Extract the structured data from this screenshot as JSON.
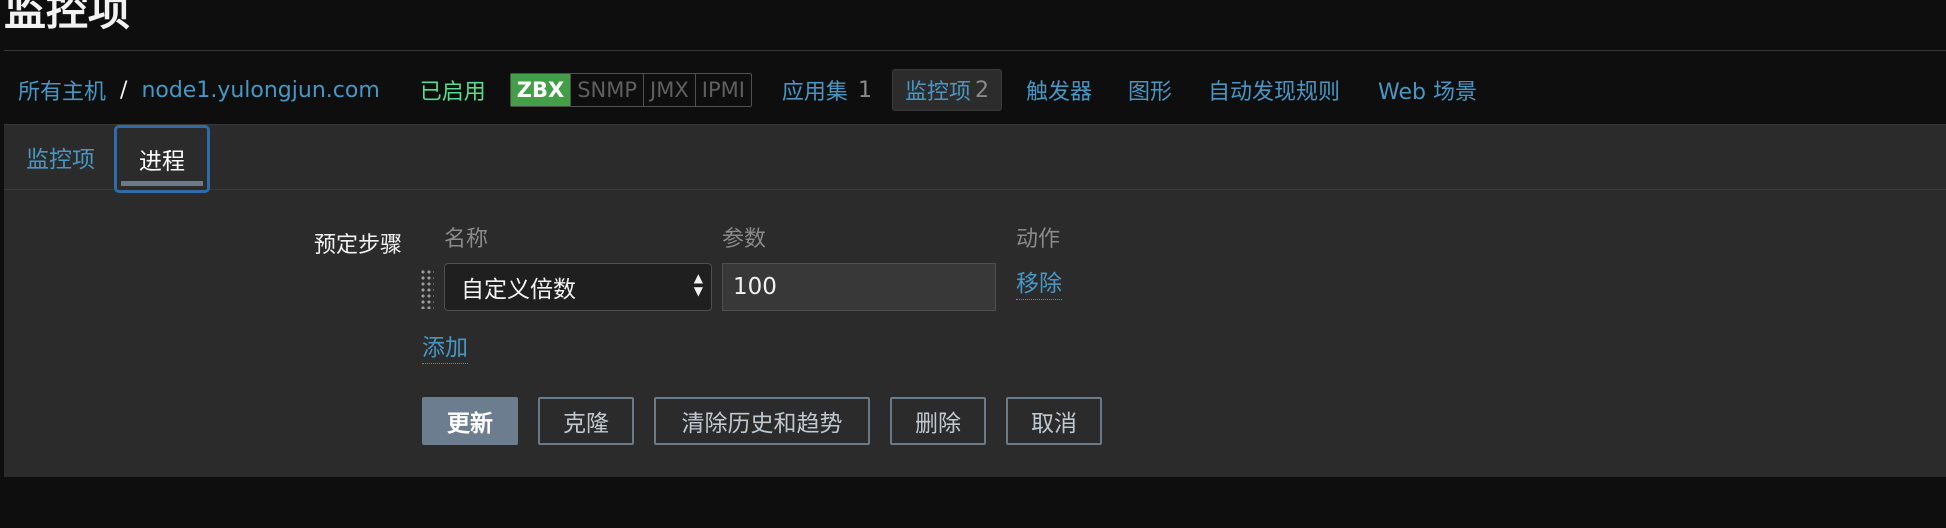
{
  "page": {
    "title": "监控项"
  },
  "breadcrumb": {
    "all_hosts": "所有主机",
    "separator": "/",
    "host": "node1.yulongjun.com",
    "status": "已启用"
  },
  "availability": [
    "ZBX",
    "SNMP",
    "JMX",
    "IPMI"
  ],
  "host_nav": [
    {
      "label": "应用集",
      "count": "1"
    },
    {
      "label": "监控项",
      "count": "2",
      "active": true
    },
    {
      "label": "触发器"
    },
    {
      "label": "图形"
    },
    {
      "label": "自动发现规则"
    },
    {
      "label": "Web 场景"
    }
  ],
  "tabs": {
    "items": "监控项",
    "process": "进程"
  },
  "preprocessing": {
    "label": "预定步骤",
    "col_name": "名称",
    "col_params": "参数",
    "col_action": "动作",
    "step_type": "自定义倍数",
    "step_param": "100",
    "remove": "移除",
    "add": "添加"
  },
  "buttons": {
    "update": "更新",
    "clone": "克隆",
    "clear": "清除历史和趋势",
    "delete": "删除",
    "cancel": "取消"
  },
  "colors": {
    "link": "#4796c4",
    "enabled": "#59db8f",
    "zbx_green": "#429e47",
    "primary_button": "#6c7d8f"
  }
}
